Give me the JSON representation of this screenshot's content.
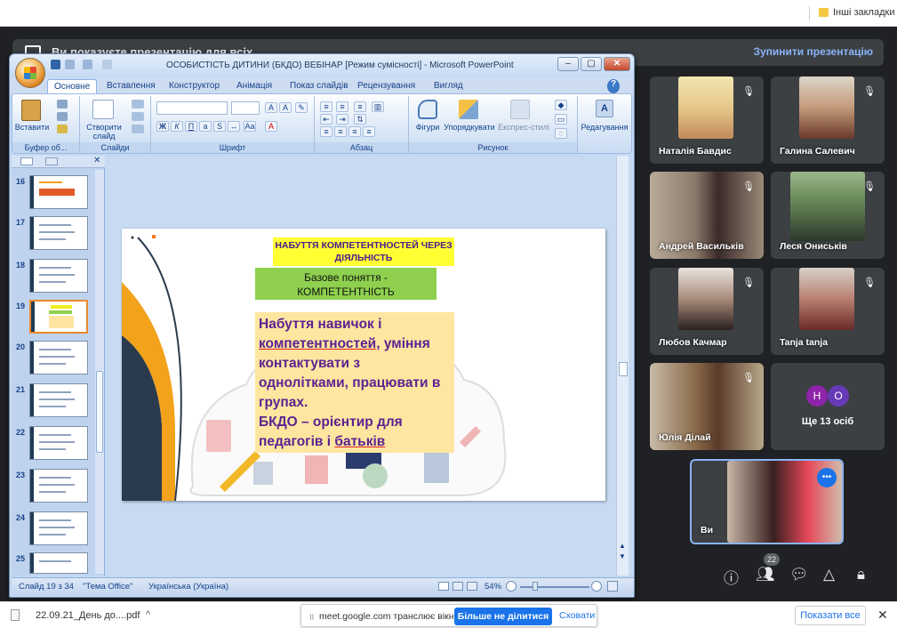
{
  "bookmarks": {
    "other": "Інші закладки"
  },
  "meet": {
    "presenting_text": "Ви показуєте презентацію для всіх",
    "stop_button": "Зупинити презентацію",
    "participants": [
      {
        "name": "Наталія Бавдис"
      },
      {
        "name": "Галина Салевич"
      },
      {
        "name": "Андрей Васильків"
      },
      {
        "name": "Леся Ониськів"
      },
      {
        "name": "Любов Качмар"
      },
      {
        "name": "Tanja tanja"
      },
      {
        "name": "Юлія Ділай"
      }
    ],
    "more": {
      "label": "Ще 13 осіб",
      "avatars": [
        "Н",
        "О"
      ]
    },
    "self_name": "Ви",
    "people_count": "22",
    "colors": {
      "avatar_n": "#8e24aa",
      "avatar_o": "#673ab7",
      "accent": "#8ab4f8"
    }
  },
  "ppt": {
    "title": "ОСОБИСТІСТЬ ДИТИНИ (БКДО) ВЕБІНАР [Режим сумісності] - Microsoft PowerPoint",
    "tabs": [
      "Основне",
      "Вставлення",
      "Конструктор",
      "Анімація",
      "Показ слайдів",
      "Рецензування",
      "Вигляд"
    ],
    "ribbon": {
      "paste": "Вставити",
      "clipboard": "Буфер об...",
      "new_slide": "Створити слайд",
      "slides": "Слайди",
      "font": "Шрифт",
      "paragraph": "Абзац",
      "shapes": "Фігури",
      "arrange": "Упорядкувати",
      "quick_styles": "Експрес-стилі",
      "drawing": "Рисунок",
      "editing": "Редагування"
    },
    "thumb_numbers": [
      "16",
      "17",
      "18",
      "19",
      "20",
      "21",
      "22",
      "23",
      "24",
      "25"
    ],
    "slide": {
      "title": "НАБУТТЯ КОМПЕТЕНТНОСТЕЙ ЧЕРЕЗ ДІЯЛЬНІСТЬ",
      "subtitle_1": "Базове поняття -",
      "subtitle_2": "КОМПЕТЕНТНІСТЬ",
      "body_1": "Набуття навичок і",
      "body_2u": "компетентностей",
      "body_2b": ", уміння",
      "body_3": "контактувати з",
      "body_4": "однолітками, працювати в",
      "body_5": "групах.",
      "body_6": "БКДО – орієнтир для",
      "body_7a": "педагогів і ",
      "body_7u": "батьків"
    },
    "status": {
      "slide": "Слайд 19 з 34",
      "theme": "\"Тема Office\"",
      "lang": "Українська (Україна)",
      "zoom": "54%"
    }
  },
  "downloads": {
    "file": "22.09.21_День до....pdf",
    "show_all": "Показати все"
  },
  "share_bar": {
    "message": "meet.google.com транслює вікно.",
    "stop": "Більше не ділитися",
    "hide": "Сховати"
  }
}
